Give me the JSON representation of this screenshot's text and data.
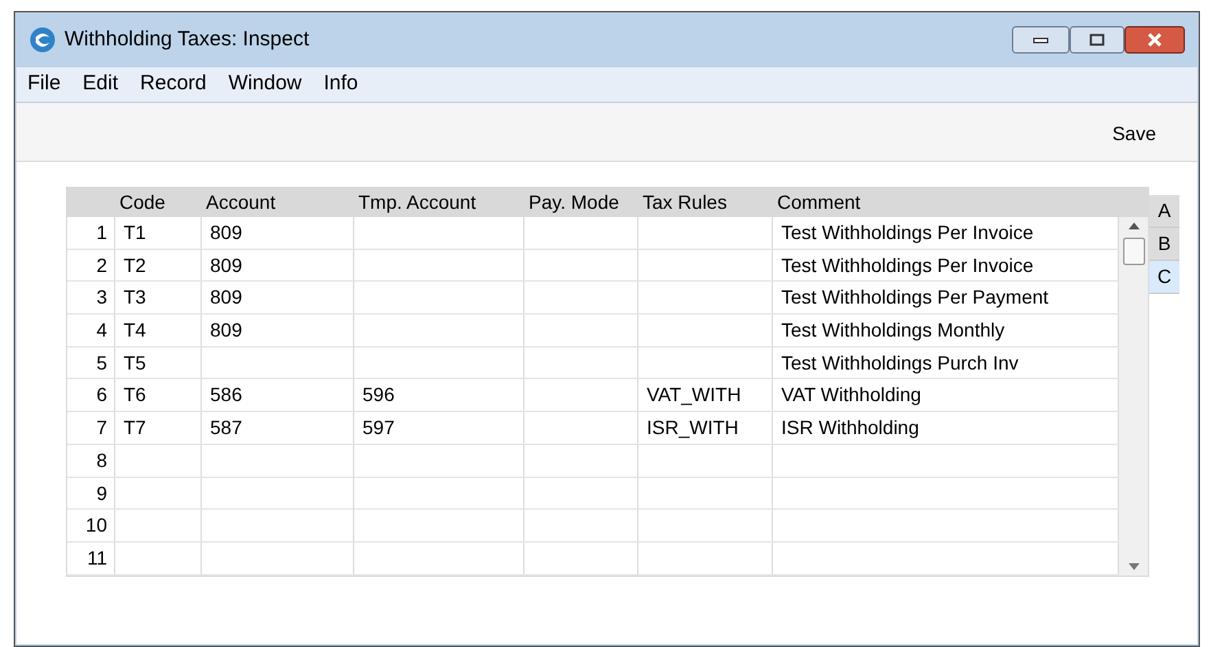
{
  "window": {
    "title": "Withholding Taxes: Inspect"
  },
  "menu": [
    "File",
    "Edit",
    "Record",
    "Window",
    "Info"
  ],
  "toolbar": {
    "save": "Save"
  },
  "table": {
    "columns": [
      "Code",
      "Account",
      "Tmp. Account",
      "Pay. Mode",
      "Tax Rules",
      "Comment"
    ],
    "rows": [
      {
        "number": "1",
        "code": "T1",
        "account": "809",
        "comment": "Test Withholdings Per Invoice"
      },
      {
        "number": "2",
        "code": "T2",
        "account": "809",
        "comment": "Test Withholdings Per Invoice"
      },
      {
        "number": "3",
        "code": "T3",
        "account": "809",
        "comment": "Test Withholdings Per Payment"
      },
      {
        "number": "4",
        "code": "T4",
        "account": "809",
        "comment": "Test Withholdings Monthly"
      },
      {
        "number": "5",
        "code": "T5",
        "comment": "Test Withholdings Purch Inv"
      },
      {
        "number": "6",
        "code": "T6",
        "account": "586",
        "tmp_account": "596",
        "tax_rules": "VAT_WITH",
        "comment": "VAT Withholding"
      },
      {
        "number": "7",
        "code": "T7",
        "account": "587",
        "tmp_account": "597",
        "tax_rules": "ISR_WITH",
        "comment": "ISR Withholding"
      },
      {
        "number": "8"
      },
      {
        "number": "9"
      },
      {
        "number": "10"
      },
      {
        "number": "11"
      }
    ]
  },
  "side_tabs": [
    {
      "label": "A",
      "selected": false
    },
    {
      "label": "B",
      "selected": false
    },
    {
      "label": "C",
      "selected": true
    }
  ]
}
